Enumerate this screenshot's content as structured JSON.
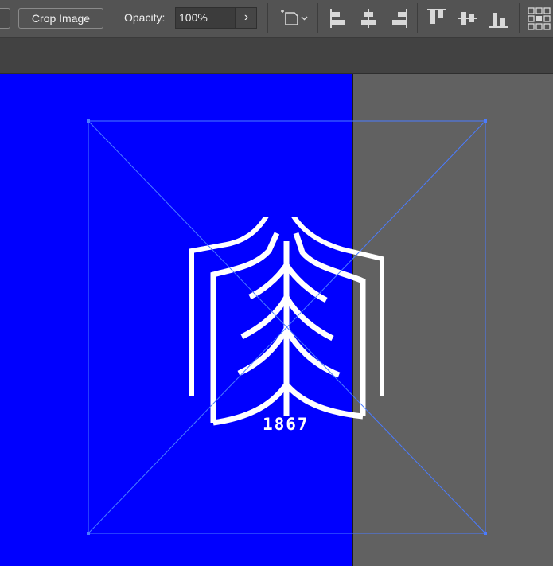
{
  "control_bar": {
    "crop_button_label": "Crop Image",
    "opacity_label": "Opacity:",
    "opacity_value": "100%",
    "opacity_arrow": "›",
    "icons": [
      "transform-reference-icon",
      "align-left-icon",
      "align-horizontal-center-icon",
      "align-right-icon",
      "align-top-icon",
      "align-vertical-center-icon",
      "align-bottom-icon",
      "distribute-grid-icon"
    ]
  },
  "canvas": {
    "artboard_color": "#0000ff",
    "pasteboard_color": "#616161",
    "selection_color": "#4a7bff",
    "logo_year": "1867"
  }
}
